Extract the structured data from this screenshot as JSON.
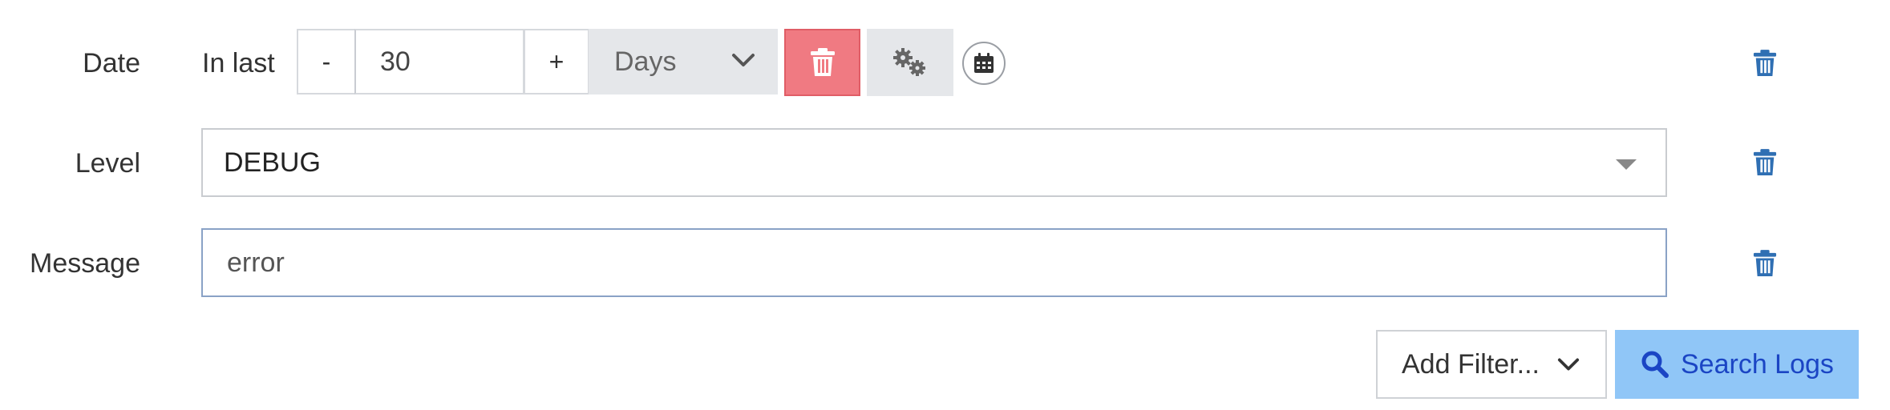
{
  "filters": {
    "date": {
      "label": "Date",
      "prefix": "In last",
      "decrement_label": "-",
      "value": "30",
      "increment_label": "+",
      "unit": "Days"
    },
    "level": {
      "label": "Level",
      "selected": "DEBUG"
    },
    "message": {
      "label": "Message",
      "value": "error"
    }
  },
  "actions": {
    "add_filter_label": "Add Filter...",
    "search_label": "Search Logs"
  },
  "colors": {
    "trash_blue": "#2f6fb3",
    "delete_red": "#f07a82",
    "search_bg": "#90c6f7",
    "search_text": "#1b45c4"
  },
  "icons": {
    "trash": "trash-icon",
    "gears": "gears-icon",
    "calendar": "calendar-icon",
    "chevron": "chevron-down-icon",
    "search": "search-icon"
  }
}
